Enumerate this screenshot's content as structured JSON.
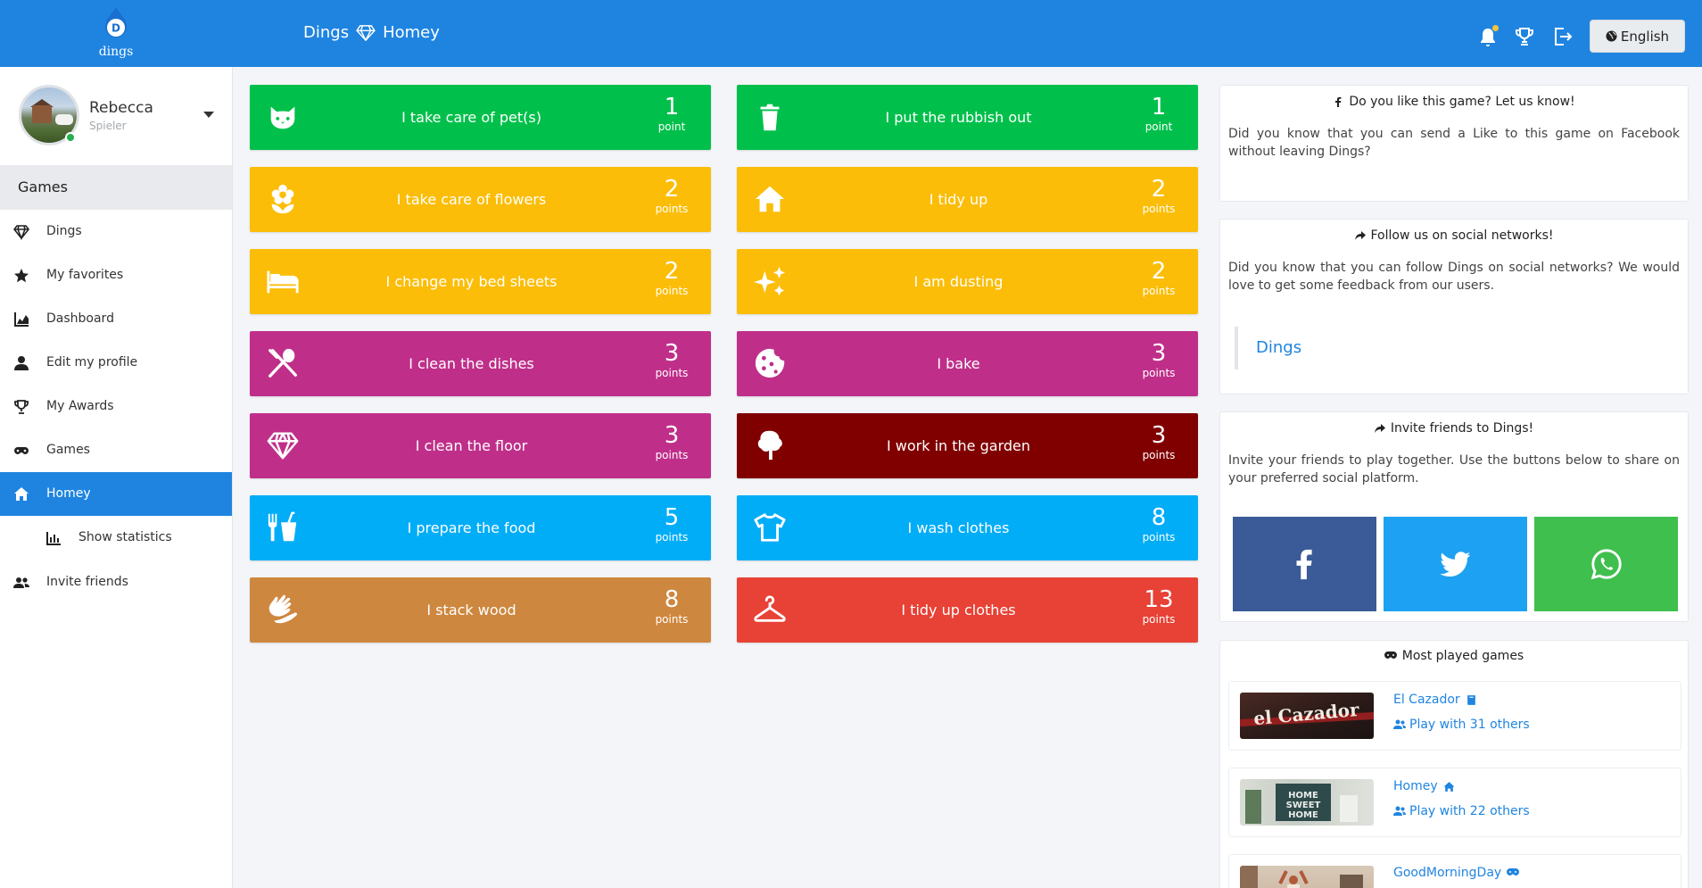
{
  "app": {
    "logo_letter": "D",
    "brand_name": "dings"
  },
  "header": {
    "crumb_first": "Dings",
    "crumb_second": "Homey",
    "language": "English",
    "icons": [
      "bell-icon",
      "trophy-icon",
      "logout-icon",
      "globe-icon"
    ]
  },
  "profile": {
    "name": "Rebecca",
    "role": "Spieler",
    "status": "online"
  },
  "nav": {
    "header": "Games",
    "items": [
      {
        "label": "Dings",
        "icon": "diamond-icon"
      },
      {
        "label": "My favorites",
        "icon": "star-icon"
      },
      {
        "label": "Dashboard",
        "icon": "chart-area-icon"
      },
      {
        "label": "Edit my profile",
        "icon": "user-icon"
      },
      {
        "label": "My Awards",
        "icon": "trophy-icon"
      },
      {
        "label": "Games",
        "icon": "gamepad-icon"
      },
      {
        "label": "Homey",
        "icon": "home-icon",
        "active": true
      },
      {
        "label": "Show statistics",
        "icon": "bar-chart-icon"
      },
      {
        "label": "Invite friends",
        "icon": "users-icon"
      }
    ]
  },
  "tasks": [
    {
      "title": "I take care of pet(s)",
      "points": "1",
      "unit": "point",
      "color": "#00c04b",
      "icon": "cat-icon"
    },
    {
      "title": "I put the rubbish out",
      "points": "1",
      "unit": "point",
      "color": "#00c04b",
      "icon": "trash-icon"
    },
    {
      "title": "I take care of flowers",
      "points": "2",
      "unit": "points",
      "color": "#fbbd08",
      "icon": "flower-icon"
    },
    {
      "title": "I tidy up",
      "points": "2",
      "unit": "points",
      "color": "#fbbd08",
      "icon": "house-icon"
    },
    {
      "title": "I change my bed sheets",
      "points": "2",
      "unit": "points",
      "color": "#fbbd08",
      "icon": "bed-icon"
    },
    {
      "title": "I am dusting",
      "points": "2",
      "unit": "points",
      "color": "#fbbd08",
      "icon": "sparkles-icon"
    },
    {
      "title": "I clean the dishes",
      "points": "3",
      "unit": "points",
      "color": "#bf2f8a",
      "icon": "utensils-icon"
    },
    {
      "title": "I bake",
      "points": "3",
      "unit": "points",
      "color": "#bf2f8a",
      "icon": "cookie-icon"
    },
    {
      "title": "I clean the floor",
      "points": "3",
      "unit": "points",
      "color": "#bf2f8a",
      "icon": "diamond-icon"
    },
    {
      "title": "I work in the garden",
      "points": "3",
      "unit": "points",
      "color": "#800000",
      "icon": "tree-icon"
    },
    {
      "title": "I prepare the food",
      "points": "5",
      "unit": "points",
      "color": "#01adf7",
      "icon": "fork-cup-icon"
    },
    {
      "title": "I wash clothes",
      "points": "8",
      "unit": "points",
      "color": "#01adf7",
      "icon": "tshirt-icon"
    },
    {
      "title": "I stack wood",
      "points": "8",
      "unit": "points",
      "color": "#ce873f",
      "icon": "hands-icon"
    },
    {
      "title": "I tidy up clothes",
      "points": "13",
      "unit": "points",
      "color": "#e84135",
      "icon": "hanger-icon"
    }
  ],
  "panels": {
    "facebook": {
      "title": "Do you like this game? Let us know!",
      "body": "Did you know that you can send a Like to this game on Facebook without leaving Dings?"
    },
    "social": {
      "title": "Follow us on social networks!",
      "body": "Did you know that you can follow Dings on social networks? We would love to get some feedback from our users.",
      "link": "Dings"
    },
    "invite": {
      "title": "Invite friends to Dings!",
      "body": "Invite your friends to play together. Use the buttons below to share on your preferred social platform.",
      "buttons": [
        {
          "icon": "facebook-icon",
          "color": "#3a5a98"
        },
        {
          "icon": "twitter-icon",
          "color": "#1da1f2"
        },
        {
          "icon": "whatsapp-icon",
          "color": "#3fbf4e"
        }
      ]
    },
    "most_played": {
      "title": "Most played games",
      "games": [
        {
          "name": "El Cazador",
          "play": "Play with 31 others",
          "thumb_text": "el Cazador",
          "icon": "book-icon"
        },
        {
          "name": "Homey",
          "play": "Play with 22 others",
          "thumb_text": "HOME SWEET HOME",
          "icon": "home-icon"
        },
        {
          "name": "GoodMorningDay",
          "play": "",
          "thumb_text": "",
          "icon": "gamepad-icon"
        }
      ]
    }
  }
}
